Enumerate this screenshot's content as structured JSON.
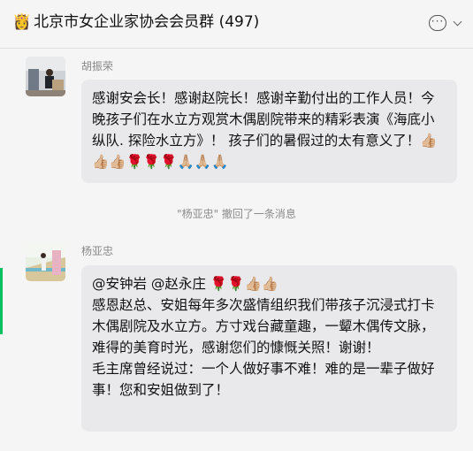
{
  "header": {
    "title_emoji": "👸",
    "title": "北京市女企业家协会会员群 (497)",
    "more_icon": "chat-bubble-ellipsis-icon",
    "dropdown_icon": "chevron-down-icon"
  },
  "messages": [
    {
      "sender": "胡振荣",
      "avatar": "photo-avatar-room",
      "text": "感谢安会长！感谢赵院长！感谢辛勤付出的工作人员！今晚孩子们在水立方观赏木偶剧院带来的精彩表演《海底小纵队. 探险水立方》！ 孩子们的暑假过的太有意义了！👍🏼👍🏼👍🏼🌹🌹🌹🙏🏼🙏🏼🙏🏼"
    },
    {
      "system": "\"杨亚忠\" 撤回了一条消息"
    },
    {
      "sender": "杨亚忠",
      "avatar": "photo-avatar-beach",
      "lines": [
        "@安钟岩 @赵永庄 🌹🌹👍🏼👍🏼",
        "感恩赵总、安姐每年多次盛情组织我们带孩子沉浸式打卡木偶剧院及水立方。方寸戏台藏童趣，一颦木偶传文脉，难得的美育时光，感谢您们的慷慨关照！谢谢！",
        "毛主席曾经说过：一个人做好事不难！难的是一辈子做好事！您和安姐做到了！"
      ]
    }
  ],
  "colors": {
    "background": "#f5f5f5",
    "bubble": "#e9e9eb",
    "accent": "#07c160"
  }
}
